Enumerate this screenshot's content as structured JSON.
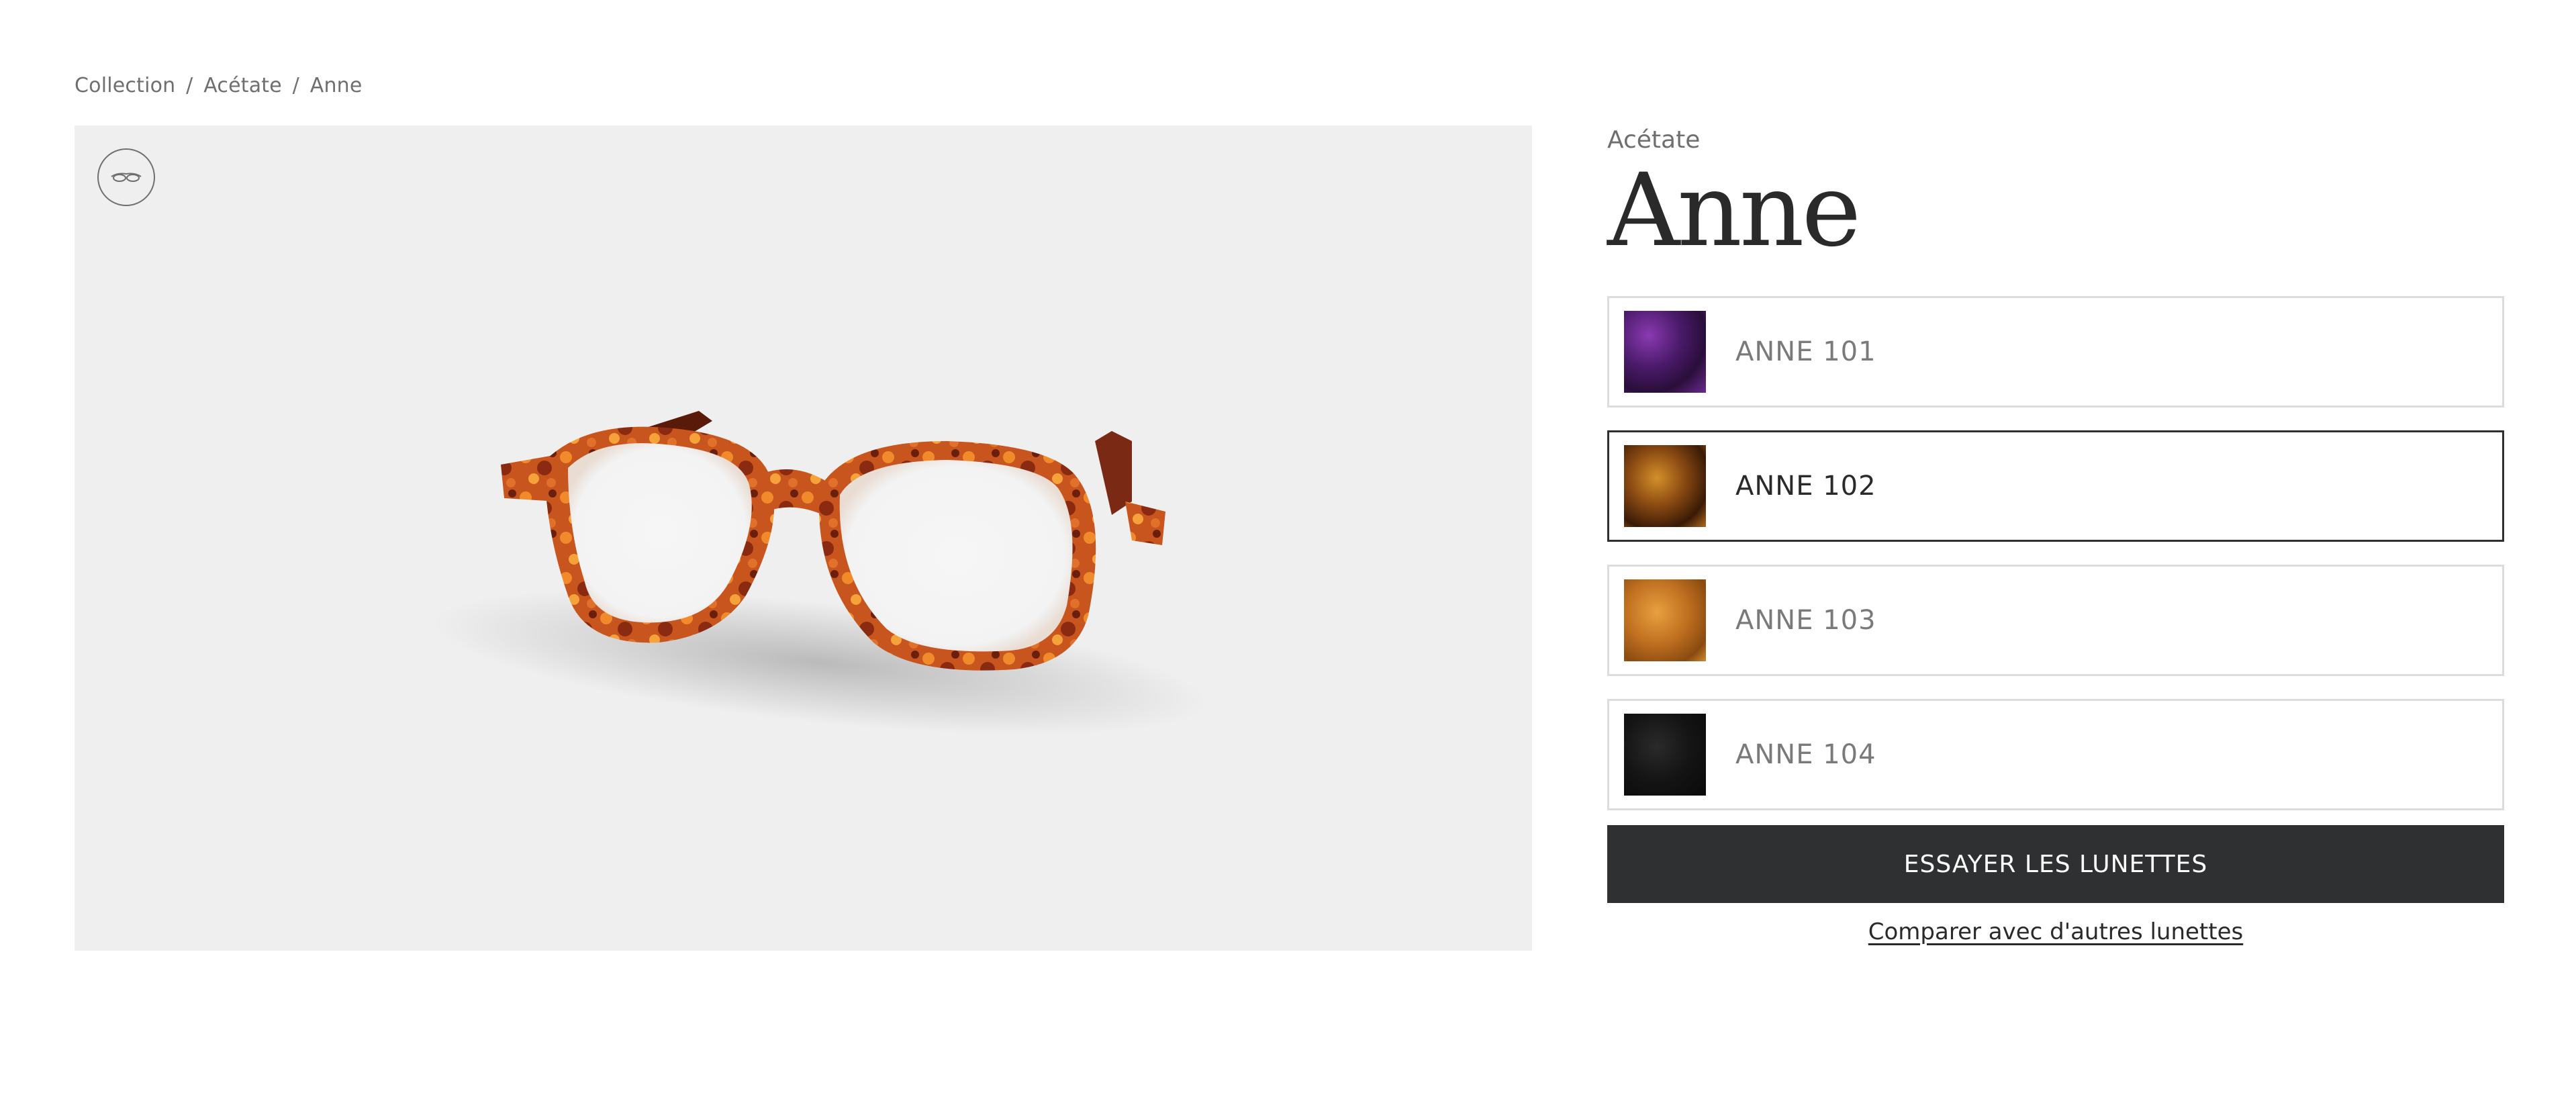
{
  "breadcrumb": {
    "items": [
      "Collection",
      "Acétate",
      "Anne"
    ],
    "separator": "/"
  },
  "viewer": {
    "toggle_icon": "glasses-outline-icon"
  },
  "product": {
    "category": "Acétate",
    "name": "Anne",
    "variants": [
      {
        "label": "ANNE 101",
        "color": "#5a2a7a",
        "selected": false
      },
      {
        "label": "ANNE 102",
        "color": "#6a3a12",
        "selected": true
      },
      {
        "label": "ANNE 103",
        "color": "#b8701c",
        "selected": false
      },
      {
        "label": "ANNE 104",
        "color": "#141414",
        "selected": false
      }
    ],
    "try_button_label": "ESSAYER LES LUNETTES",
    "compare_link_label": "Comparer avec d'autres lunettes"
  },
  "colors": {
    "accent": "#2f3031",
    "frame": "#c8541e"
  }
}
